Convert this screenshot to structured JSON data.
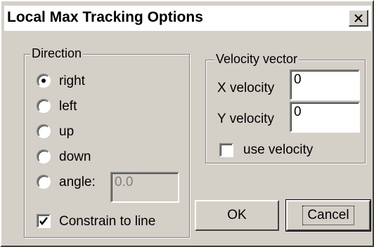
{
  "window": {
    "title": "Local Max Tracking Options"
  },
  "direction": {
    "group_label": "Direction",
    "options": [
      {
        "label": "right",
        "selected": true
      },
      {
        "label": "left",
        "selected": false
      },
      {
        "label": "up",
        "selected": false
      },
      {
        "label": "down",
        "selected": false
      },
      {
        "label": "angle:",
        "selected": false
      }
    ],
    "angle_value": "0.0",
    "constrain_label": "Constrain to line",
    "constrain_checked": true
  },
  "velocity": {
    "group_label": "Velocity vector",
    "x_label": "X velocity",
    "x_value": "0",
    "y_label": "Y velocity",
    "y_value": "0",
    "use_label": "use velocity",
    "use_checked": false
  },
  "buttons": {
    "ok": "OK",
    "cancel": "Cancel"
  }
}
